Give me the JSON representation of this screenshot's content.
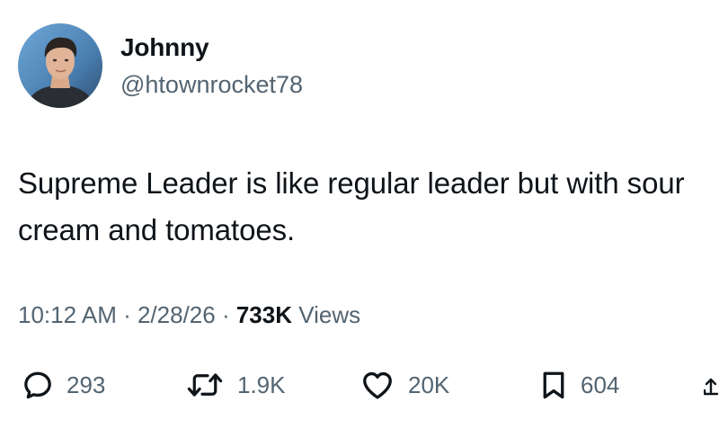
{
  "author": {
    "display_name": "Johnny",
    "handle": "@htownrocket78"
  },
  "tweet": {
    "text": "Supreme Leader is like regular leader but with sour cream and tomatoes."
  },
  "meta": {
    "time": "10:12 AM",
    "separator1": " · ",
    "date": "2/28/26",
    "separator2": " · ",
    "views_count": "733K",
    "views_label": " Views"
  },
  "actions": {
    "replies": "293",
    "reposts": "1.9K",
    "likes": "20K",
    "bookmarks": "604"
  },
  "icons": {
    "reply": "reply-icon",
    "repost": "repost-icon",
    "like": "heart-icon",
    "bookmark": "bookmark-icon",
    "share": "share-icon"
  },
  "colors": {
    "text_primary": "#0f1419",
    "text_secondary": "#536471",
    "background": "#ffffff"
  }
}
